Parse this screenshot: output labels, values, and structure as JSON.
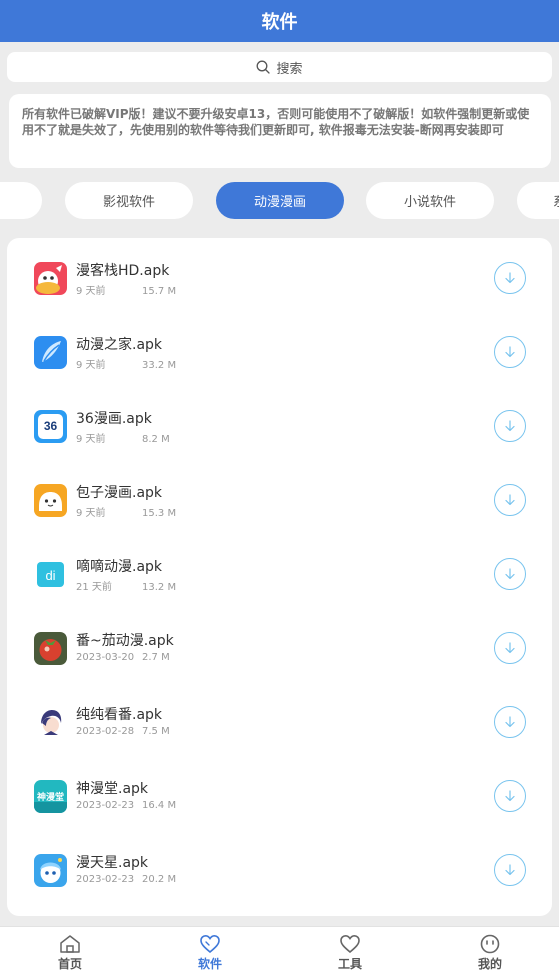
{
  "header": {
    "title": "软件"
  },
  "search": {
    "placeholder": "搜索",
    "icon": "search-icon"
  },
  "notice": {
    "text": "所有软件已破解VIP版！建议不要升级安卓13，否则可能使用不了破解版！如软件强制更新或使用不了就是失效了，先使用别的软件等待我们更新即可, 软件报毒无法安装-断网再安装即可"
  },
  "tabs": [
    {
      "label": ""
    },
    {
      "label": "影视软件"
    },
    {
      "label": "动漫漫画",
      "active": true
    },
    {
      "label": "小说软件"
    },
    {
      "label": "系"
    }
  ],
  "apps": [
    {
      "name": "漫客栈HD.apk",
      "date": "9 天前",
      "size": "15.7 M",
      "icon": "mankezhan-app-icon"
    },
    {
      "name": "动漫之家.apk",
      "date": "9 天前",
      "size": "33.2 M",
      "icon": "dongmanzhijia-app-icon"
    },
    {
      "name": "36漫画.apk",
      "date": "9 天前",
      "size": "8.2 M",
      "icon": "36manhua-app-icon",
      "icon_text": "36"
    },
    {
      "name": "包子漫画.apk",
      "date": "9 天前",
      "size": "15.3 M",
      "icon": "baozi-app-icon"
    },
    {
      "name": "嘀嘀动漫.apk",
      "date": "21 天前",
      "size": "13.2 M",
      "icon": "didi-app-icon",
      "icon_text": "di"
    },
    {
      "name": "番~茄动漫.apk",
      "date": "2023-03-20",
      "size": "2.7 M",
      "icon": "fanqie-app-icon"
    },
    {
      "name": "纯纯看番.apk",
      "date": "2023-02-28",
      "size": "7.5 M",
      "icon": "chunchun-app-icon"
    },
    {
      "name": "神漫堂.apk",
      "date": "2023-02-23",
      "size": "16.4 M",
      "icon": "shenmantang-app-icon",
      "icon_text": "神漫堂"
    },
    {
      "name": "漫天星.apk",
      "date": "2023-02-23",
      "size": "20.2 M",
      "icon": "mantianxing-app-icon"
    }
  ],
  "bottom_nav": [
    {
      "label": "首页",
      "icon": "home-icon"
    },
    {
      "label": "软件",
      "icon": "heart-icon",
      "active": true
    },
    {
      "label": "工具",
      "icon": "heart-outline-icon"
    },
    {
      "label": "我的",
      "icon": "smiley-icon"
    }
  ],
  "colors": {
    "primary": "#3f78d8",
    "download": "#79c4ee",
    "background": "#ececec"
  }
}
